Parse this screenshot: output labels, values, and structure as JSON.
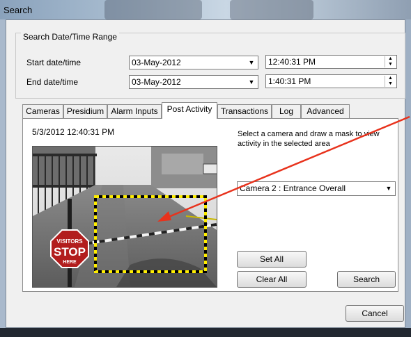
{
  "window": {
    "title": "Search"
  },
  "date_range": {
    "group_label": "Search Date/Time Range",
    "start_label": "Start date/time",
    "start_date": "03-May-2012",
    "start_time": "12:40:31 PM",
    "end_label": "End date/time",
    "end_date": "03-May-2012",
    "end_time": "1:40:31 PM"
  },
  "tabs": [
    {
      "label": "Cameras"
    },
    {
      "label": "Presidium"
    },
    {
      "label": "Alarm Inputs"
    },
    {
      "label": "Post Activity"
    },
    {
      "label": "Transactions"
    },
    {
      "label": "Log"
    },
    {
      "label": "Advanced"
    }
  ],
  "active_tab": "Post Activity",
  "post_activity": {
    "timestamp": "5/3/2012 12:40:31 PM",
    "instruction_line1": "Select a camera and draw a mask to view",
    "instruction_line2": "activity in the selected area",
    "camera_selected": "Camera 2 : Entrance Overall",
    "set_all_label": "Set All",
    "clear_all_label": "Clear All",
    "search_label": "Search",
    "sign_line1": "VISITORS",
    "sign_line2": "STOP",
    "sign_line3": "HERE"
  },
  "footer": {
    "cancel_label": "Cancel"
  },
  "colors": {
    "annotation_arrow": "#e8321c",
    "mask_outline": "#ffee00"
  },
  "icons": [
    "chevron-down-icon",
    "spin-up-icon",
    "spin-down-icon",
    "annotation-arrow-icon"
  ]
}
